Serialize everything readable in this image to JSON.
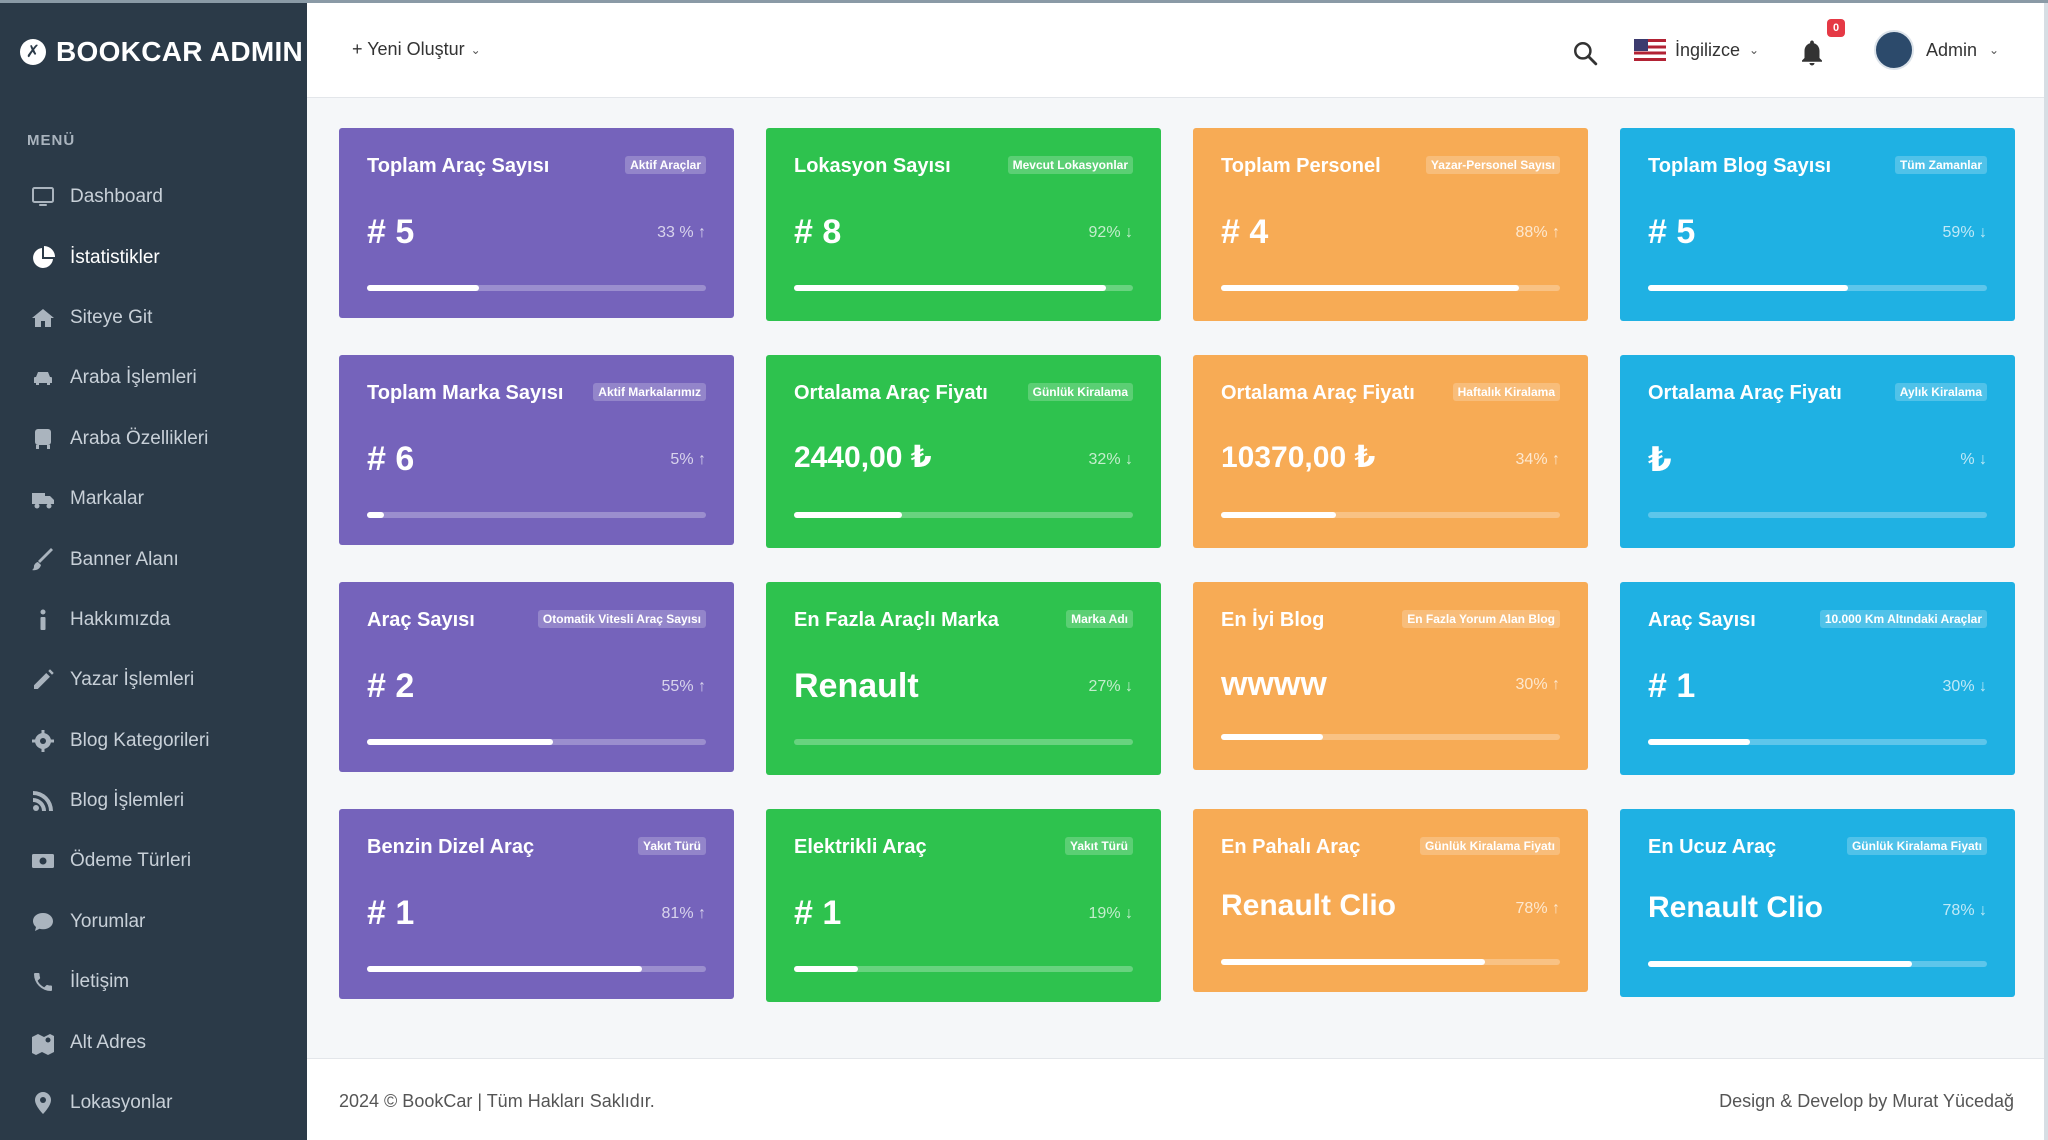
{
  "brand": {
    "name": "BOOKCAR ADMIN",
    "logo_glyph": "✗"
  },
  "sidebar": {
    "menu_title": "MENÜ",
    "items": [
      {
        "label": "Dashboard",
        "icon": "monitor-icon"
      },
      {
        "label": "İstatistikler",
        "icon": "pie-chart-icon",
        "active": true
      },
      {
        "label": "Siteye Git",
        "icon": "home-icon"
      },
      {
        "label": "Araba İşlemleri",
        "icon": "car-icon"
      },
      {
        "label": "Araba Özellikleri",
        "icon": "bus-icon"
      },
      {
        "label": "Markalar",
        "icon": "truck-icon"
      },
      {
        "label": "Banner Alanı",
        "icon": "brush-icon"
      },
      {
        "label": "Hakkımızda",
        "icon": "info-icon"
      },
      {
        "label": "Yazar İşlemleri",
        "icon": "pencil-icon"
      },
      {
        "label": "Blog Kategorileri",
        "icon": "gear-icon"
      },
      {
        "label": "Blog İşlemleri",
        "icon": "rss-icon"
      },
      {
        "label": "Ödeme Türleri",
        "icon": "money-icon"
      },
      {
        "label": "Yorumlar",
        "icon": "comment-icon"
      },
      {
        "label": "İletişim",
        "icon": "phone-icon"
      },
      {
        "label": "Alt Adres",
        "icon": "map-icon"
      },
      {
        "label": "Lokasyonlar",
        "icon": "pin-icon"
      }
    ]
  },
  "header": {
    "new_button": "+ Yeni Oluştur",
    "language": "İngilizce",
    "notification_count": "0",
    "user": "Admin"
  },
  "colors": {
    "purple": "#7563bb",
    "green": "#2ec24e",
    "orange": "#f7ab55",
    "blue": "#1fb1e3",
    "sidebar": "#2b3a48"
  },
  "cards": [
    {
      "title": "Toplam Araç Sayısı",
      "label": "Aktif Araçlar",
      "value": "# 5",
      "pct": "33 % ↑",
      "progress": 33,
      "color": "purple"
    },
    {
      "title": "Lokasyon Sayısı",
      "label": "Mevcut Lokasyonlar",
      "value": "# 8",
      "pct": "92% ↓",
      "progress": 92,
      "color": "green"
    },
    {
      "title": "Toplam Personel",
      "label": "Yazar-Personel Sayısı",
      "value": "# 4",
      "pct": "88% ↑",
      "progress": 88,
      "color": "orange"
    },
    {
      "title": "Toplam Blog Sayısı",
      "label": "Tüm Zamanlar",
      "value": "# 5",
      "pct": "59% ↓",
      "progress": 59,
      "color": "blue"
    },
    {
      "title": "Toplam Marka Sayısı",
      "label": "Aktif Markalarımız",
      "value": "# 6",
      "pct": "5% ↑",
      "progress": 5,
      "color": "purple"
    },
    {
      "title": "Ortalama Araç Fiyatı",
      "label": "Günlük Kiralama",
      "value": "2440,00 ₺",
      "pct": "32% ↓",
      "progress": 32,
      "color": "green"
    },
    {
      "title": "Ortalama Araç Fiyatı",
      "label": "Haftalık Kiralama",
      "value": "10370,00 ₺",
      "pct": "34% ↑",
      "progress": 34,
      "color": "orange"
    },
    {
      "title": "Ortalama Araç Fiyatı",
      "label": "Aylık Kiralama",
      "value": "₺",
      "pct": "% ↓",
      "progress": 0,
      "color": "blue"
    },
    {
      "title": "Araç Sayısı",
      "label": "Otomatik Vitesli Araç Sayısı",
      "value": "# 2",
      "pct": "55% ↑",
      "progress": 55,
      "color": "purple"
    },
    {
      "title": "En Fazla Araçlı Marka",
      "label": "Marka Adı",
      "value": "Renault",
      "pct": "27% ↓",
      "progress": 0,
      "color": "green"
    },
    {
      "title": "En İyi Blog",
      "label": "En Fazla Yorum Alan Blog",
      "value": "wwww",
      "pct": "30% ↑",
      "progress": 30,
      "color": "orange"
    },
    {
      "title": "Araç Sayısı",
      "label": "10.000 Km Altındaki Araçlar",
      "value": "# 1",
      "pct": "30% ↓",
      "progress": 30,
      "color": "blue"
    },
    {
      "title": "Benzin Dizel Araç",
      "label": "Yakıt Türü",
      "value": "# 1",
      "pct": "81% ↑",
      "progress": 81,
      "color": "purple"
    },
    {
      "title": "Elektrikli Araç",
      "label": "Yakıt Türü",
      "value": "# 1",
      "pct": "19% ↓",
      "progress": 19,
      "color": "green"
    },
    {
      "title": "En Pahalı Araç",
      "label": "Günlük Kiralama Fiyatı",
      "value": "Renault Clio",
      "pct": "78% ↑",
      "progress": 78,
      "color": "orange"
    },
    {
      "title": "En Ucuz Araç",
      "label": "Günlük Kiralama Fiyatı",
      "value": "Renault Clio",
      "pct": "78% ↓",
      "progress": 78,
      "color": "blue"
    }
  ],
  "footer": {
    "copyright": "2024 © BookCar | Tüm Hakları Saklıdır.",
    "credit": "Design & Develop by Murat Yücedağ"
  }
}
